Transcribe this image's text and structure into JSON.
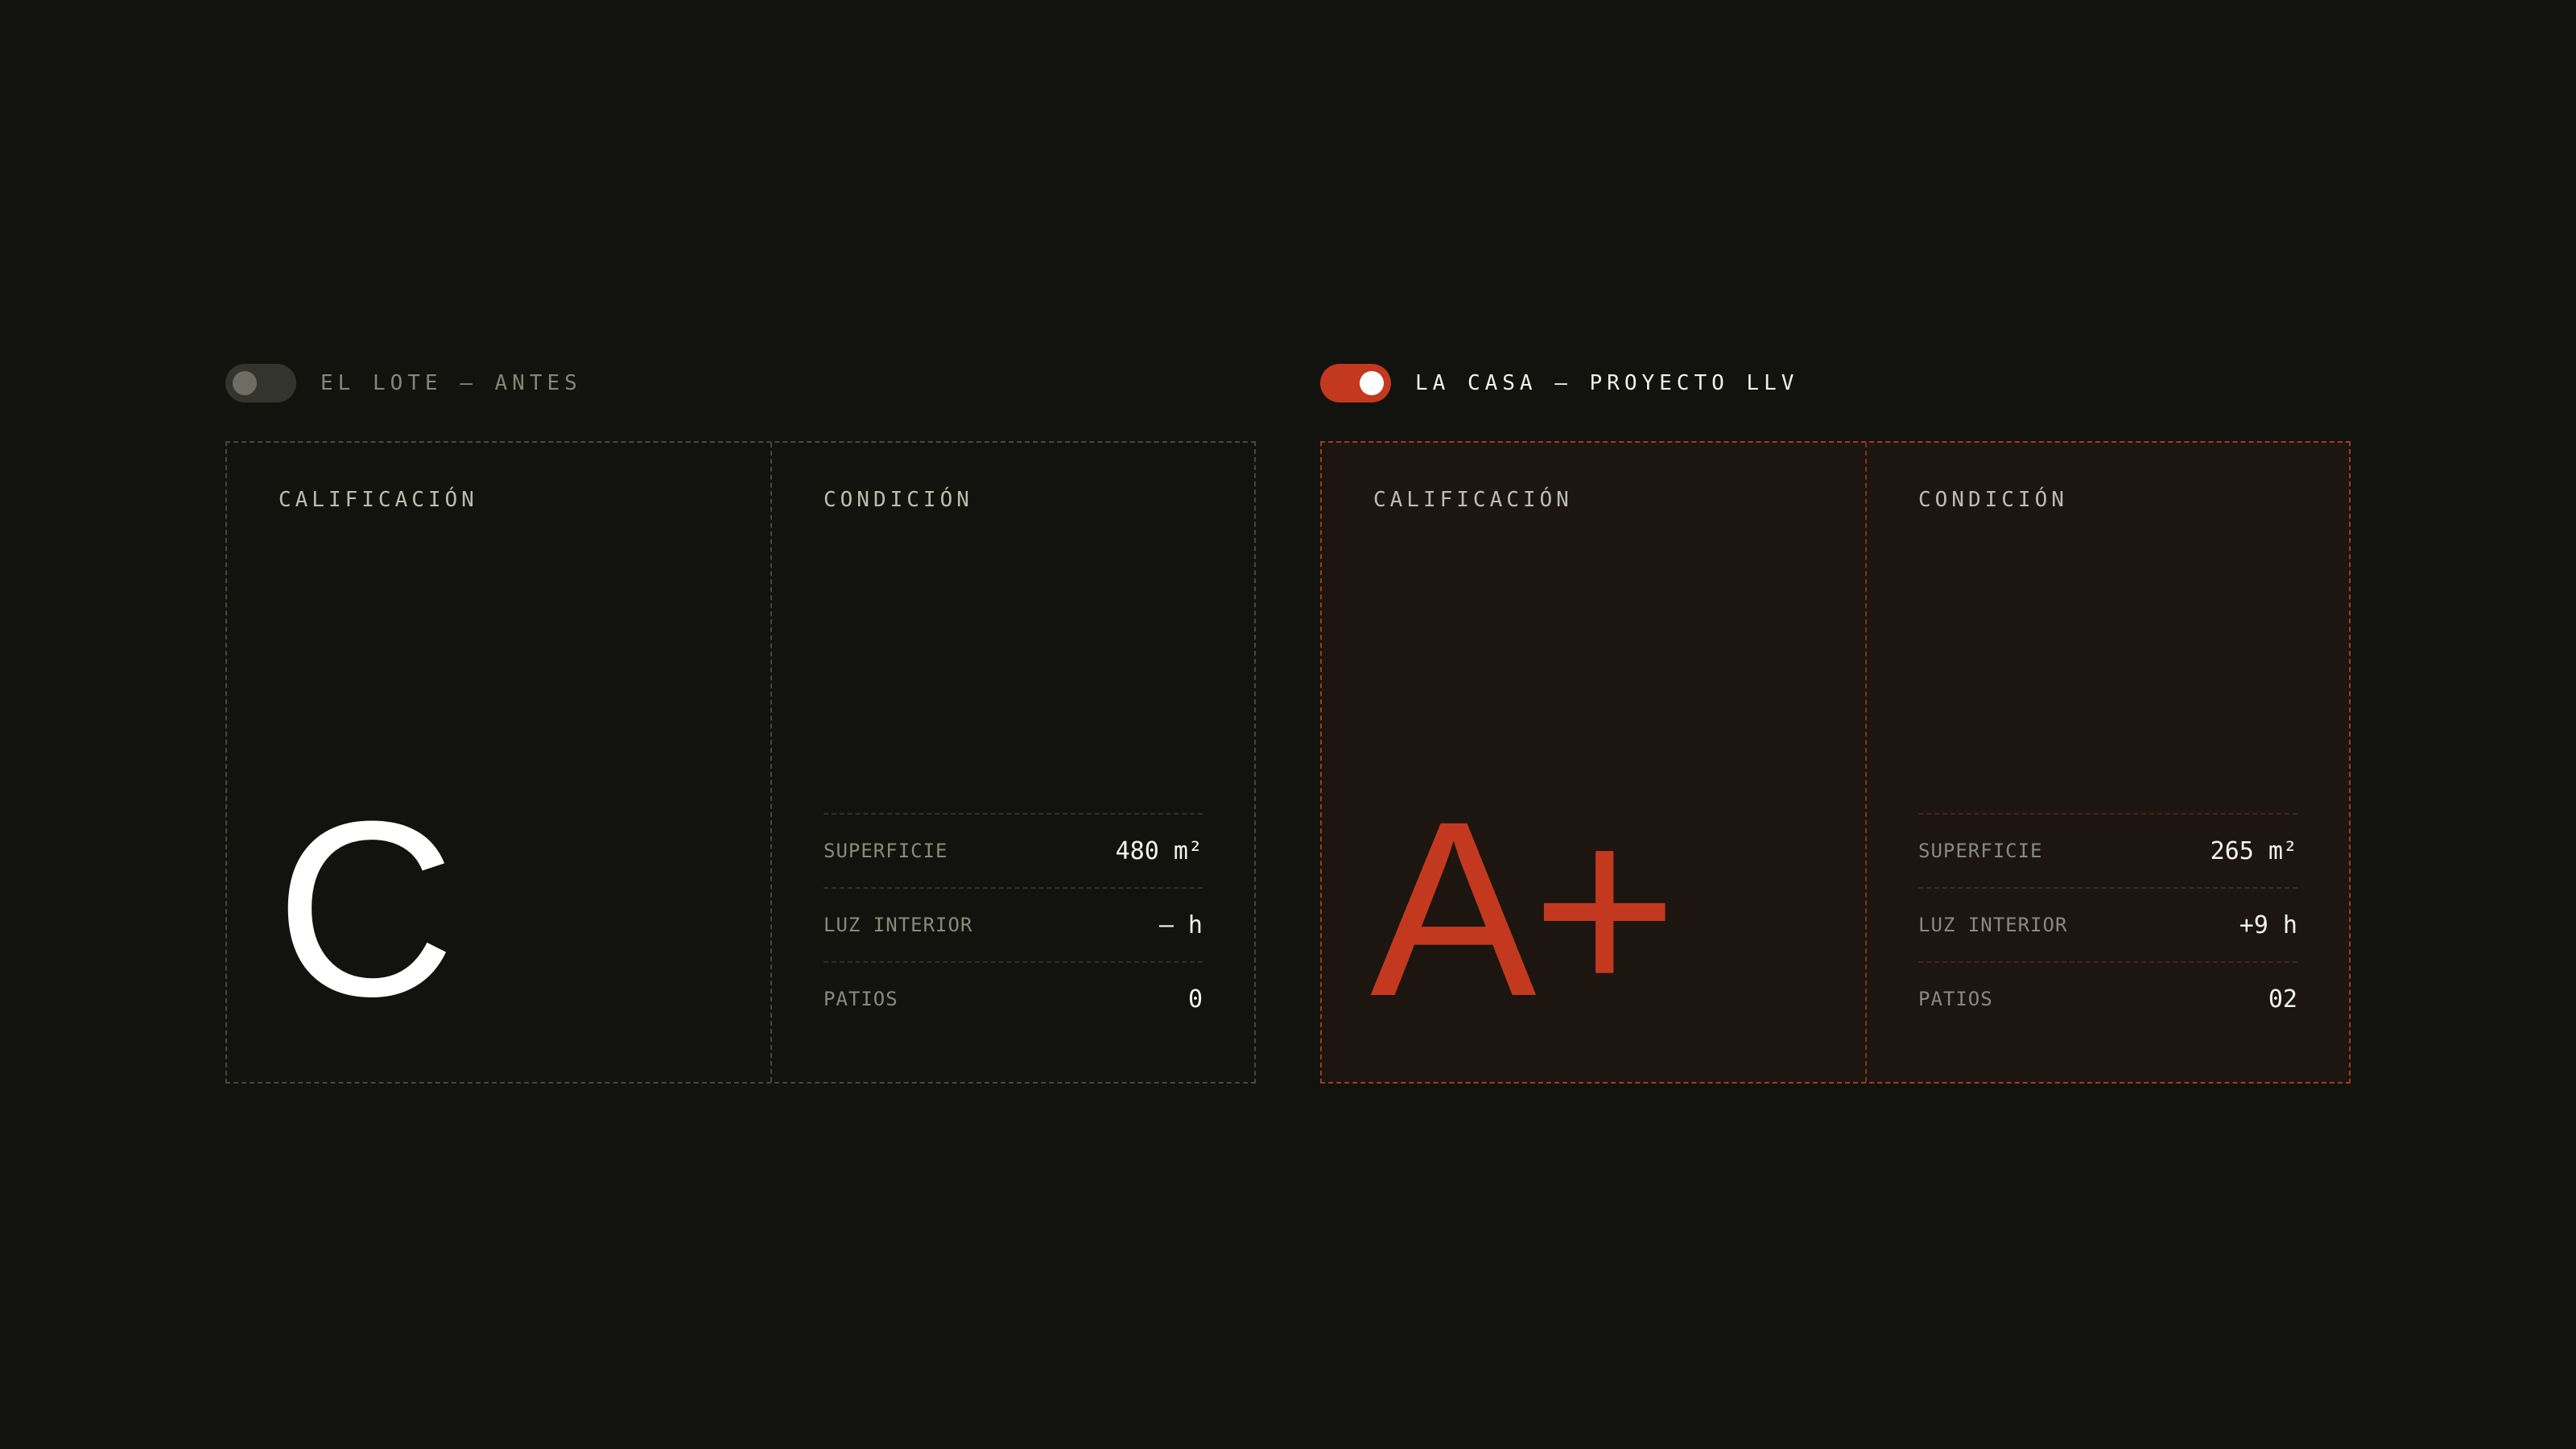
{
  "before": {
    "toggle_on": false,
    "label": "EL LOTE — ANTES",
    "grade_title": "CALIFICACIÓN",
    "grade": "C",
    "condition_title": "CONDICIÓN",
    "metrics": [
      {
        "label": "SUPERFICIE",
        "value": "480 m²"
      },
      {
        "label": "LUZ INTERIOR",
        "value": "— h"
      },
      {
        "label": "PATIOS",
        "value": "0"
      }
    ]
  },
  "after": {
    "toggle_on": true,
    "label": "LA CASA — PROYECTO LLV",
    "grade_title": "CALIFICACIÓN",
    "grade": "A+",
    "condition_title": "CONDICIÓN",
    "metrics": [
      {
        "label": "SUPERFICIE",
        "value": "265 m²"
      },
      {
        "label": "LUZ INTERIOR",
        "value": "+9 h"
      },
      {
        "label": "PATIOS",
        "value": "02"
      }
    ]
  },
  "colors": {
    "background": "#12120e",
    "accent": "#c2391f",
    "accent_card": "#1c1510",
    "muted_border": "#47463f",
    "text": "#f4f3ec"
  }
}
